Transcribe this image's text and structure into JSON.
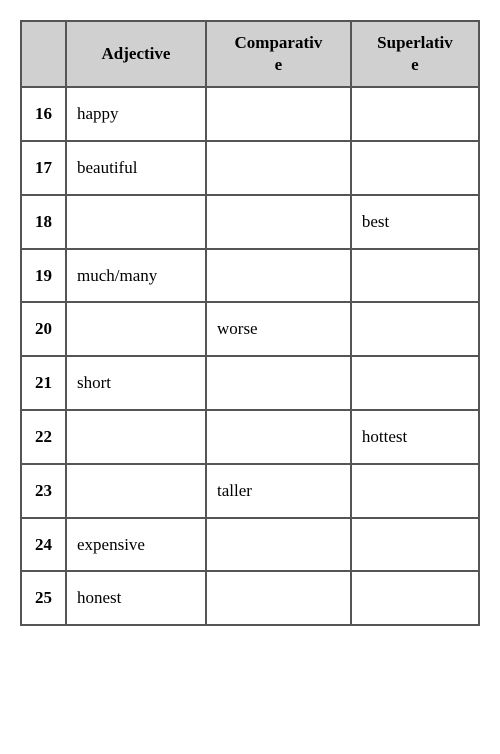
{
  "table": {
    "headers": [
      {
        "id": "num-header",
        "label": ""
      },
      {
        "id": "adjective-header",
        "label": "Adjective"
      },
      {
        "id": "comparative-header",
        "label": "Comparative"
      },
      {
        "id": "superlative-header",
        "label": "Superlative"
      }
    ],
    "rows": [
      {
        "num": "16",
        "adjective": "happy",
        "comparative": "",
        "superlative": ""
      },
      {
        "num": "17",
        "adjective": "beautiful",
        "comparative": "",
        "superlative": ""
      },
      {
        "num": "18",
        "adjective": "",
        "comparative": "",
        "superlative": "best"
      },
      {
        "num": "19",
        "adjective": "much/many",
        "comparative": "",
        "superlative": ""
      },
      {
        "num": "20",
        "adjective": "",
        "comparative": "worse",
        "superlative": ""
      },
      {
        "num": "21",
        "adjective": "short",
        "comparative": "",
        "superlative": ""
      },
      {
        "num": "22",
        "adjective": "",
        "comparative": "",
        "superlative": "hottest"
      },
      {
        "num": "23",
        "adjective": "",
        "comparative": "taller",
        "superlative": ""
      },
      {
        "num": "24",
        "adjective": "expensive",
        "comparative": "",
        "superlative": ""
      },
      {
        "num": "25",
        "adjective": "honest",
        "comparative": "",
        "superlative": ""
      }
    ]
  }
}
